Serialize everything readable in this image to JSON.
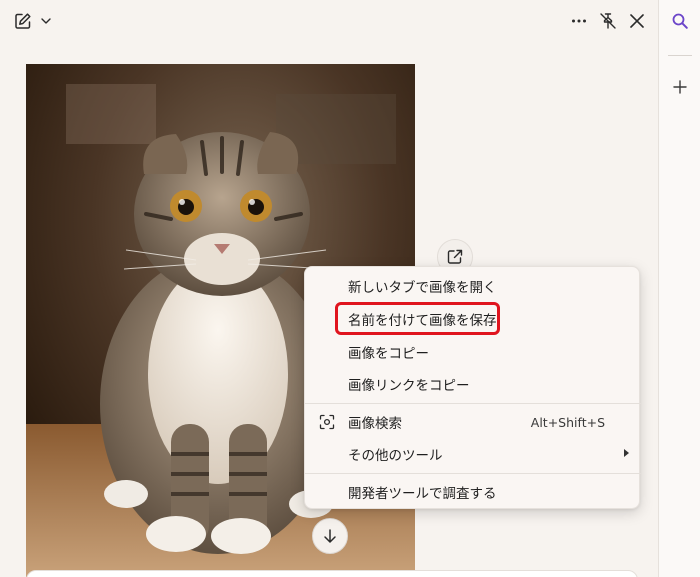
{
  "menu": {
    "items": [
      {
        "label": "新しいタブで画像を開く"
      },
      {
        "label": "名前を付けて画像を保存"
      },
      {
        "label": "画像をコピー"
      },
      {
        "label": "画像リンクをコピー"
      },
      {
        "label": "画像検索",
        "shortcut": "Alt+Shift+S",
        "icon": "visual-search-icon"
      },
      {
        "label": "その他のツール",
        "submenu": true
      },
      {
        "label": "開発者ツールで調査する"
      }
    ]
  },
  "image": {
    "subject": "scottish-fold-cat"
  },
  "colors": {
    "background": "#f7f3ef",
    "menu_background": "#faf6f3",
    "highlight": "#e0141e",
    "search_accent": "#6b45c9"
  }
}
